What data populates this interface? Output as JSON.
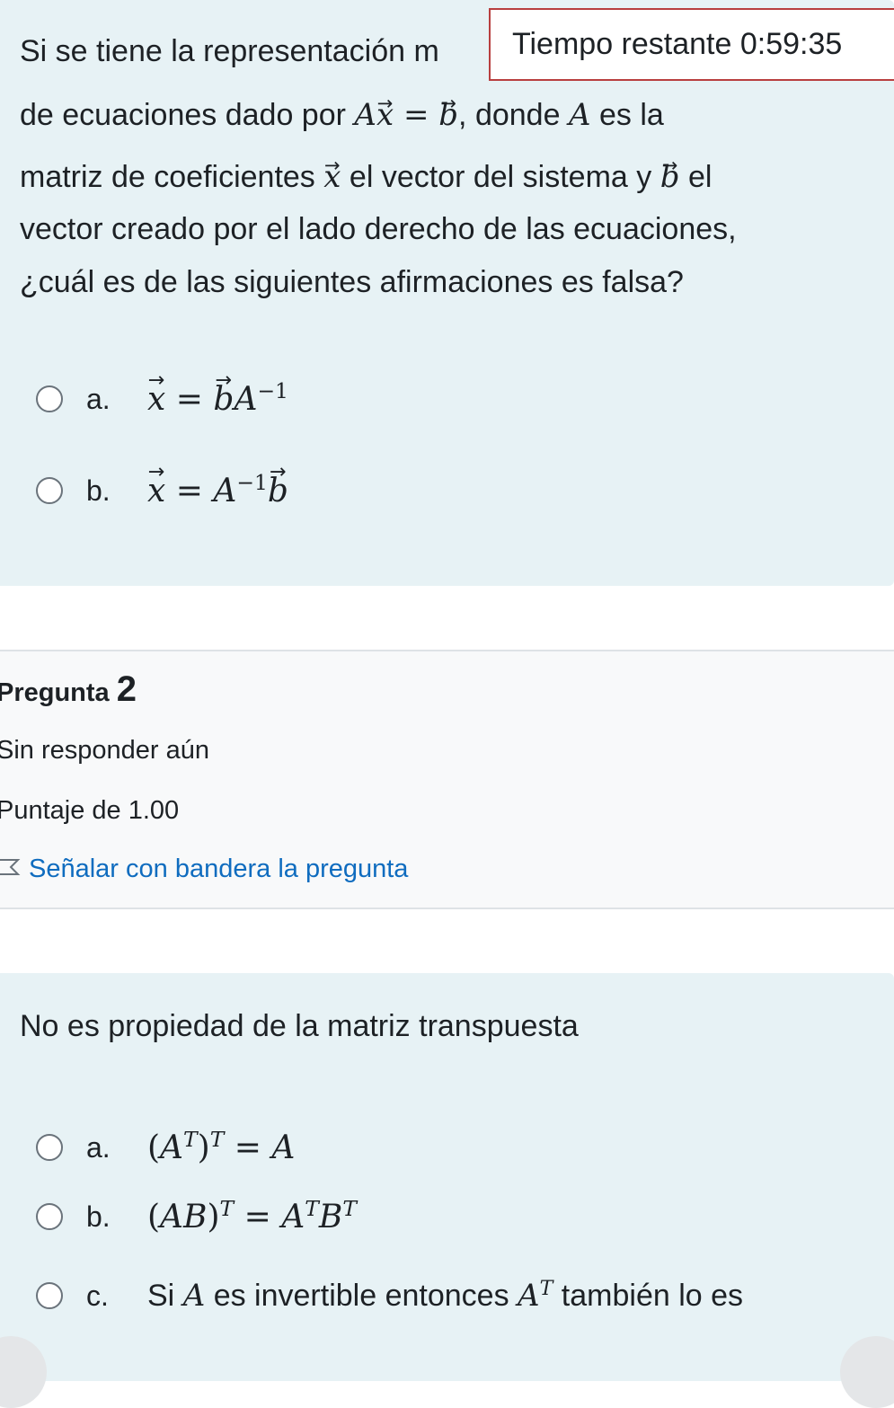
{
  "timer": {
    "label": "Tiempo restante",
    "value": "0:59:35"
  },
  "question1": {
    "text_line1": "Si se tiene la representación m",
    "text_line2_start": "de ecuaciones dado por",
    "text_line2_mid": "=",
    "text_line2_end": ", donde",
    "text_line2_var": "A",
    "text_line2_tail": "es la",
    "text_line3_start": "matriz de coeficientes",
    "text_line3_mid": "el vector del sistema y",
    "text_line3_end": "el",
    "text_line4": "vector creado por el lado derecho de las ecuaciones,",
    "text_line5": "¿cuál es de las siguientes afirmaciones es falsa?",
    "options": [
      {
        "label": "a.",
        "lhs": "x",
        "eq": "=",
        "b": "b",
        "A": "A",
        "exp": "−1"
      },
      {
        "label": "b.",
        "lhs": "x",
        "eq": "=",
        "A": "A",
        "exp": "−1",
        "b": "b"
      }
    ]
  },
  "info": {
    "title": "Pregunta",
    "number": "2",
    "status": "Sin responder aún",
    "score": "Puntaje de 1.00",
    "flag_label": "Señalar con bandera la pregunta"
  },
  "question2": {
    "text": "No es propiedad de la matriz transpuesta",
    "options": [
      {
        "label": "a.",
        "formula": "(A^T)^T = A"
      },
      {
        "label": "b.",
        "formula": "(AB)^T = A^T B^T"
      },
      {
        "label": "c.",
        "pre": "Si",
        "var": "A",
        "mid": "es invertible entonces",
        "varT": "A",
        "sup": "T",
        "post": "también lo es"
      }
    ]
  },
  "colors": {
    "question_bg": "#e7f2f5",
    "info_bg": "#f8f9fa",
    "link": "#0f6cbf",
    "timer_border": "#b83f3f"
  }
}
